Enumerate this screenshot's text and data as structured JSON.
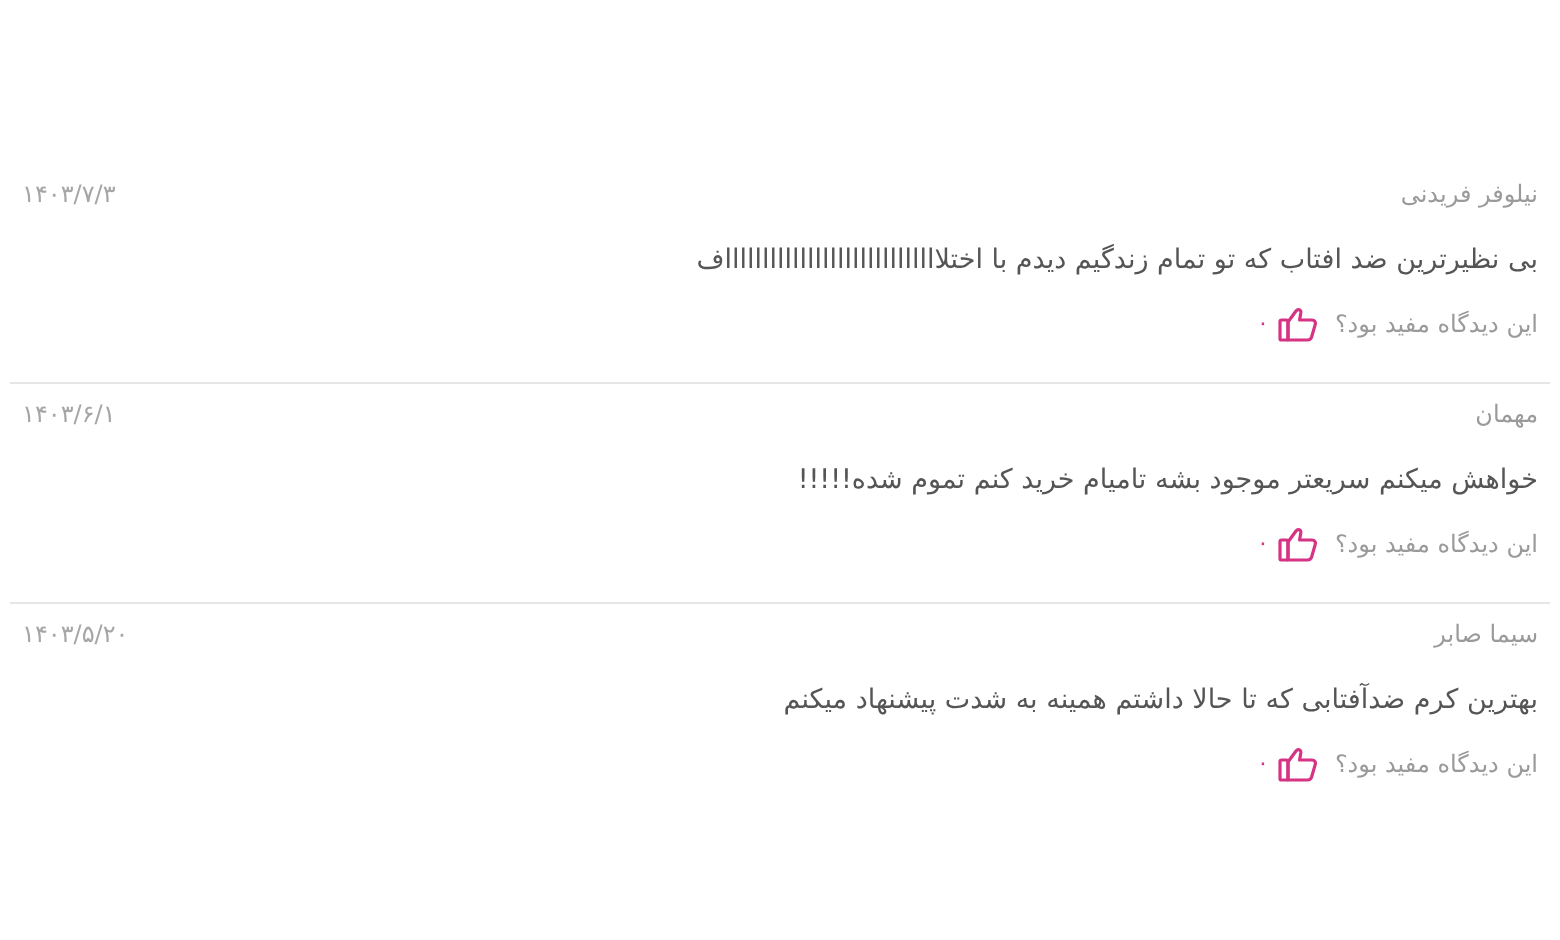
{
  "comments": [
    {
      "author": "نیلوفر فریدنی",
      "date": "۱۴۰۳/۷/۳",
      "text": "بی نظیرترین ضد افتاب که تو تمام زندگیم دیدم با اختلاااااااااااااااااااااااااااااف",
      "helpful_label": "این دیدگاه مفید بود؟",
      "likes": "۰"
    },
    {
      "author": "مهمان",
      "date": "۱۴۰۳/۶/۱",
      "text": "خواهش میکنم سریعتر موجود بشه تامیام خرید کنم تموم شده!!!!!",
      "helpful_label": "این دیدگاه مفید بود؟",
      "likes": "۰"
    },
    {
      "author": "سیما صابر",
      "date": "۱۴۰۳/۵/۲۰",
      "text": "بهترین کرم ضدآفتابی که تا حالا داشتم همینه به شدت پیشنهاد میکنم",
      "helpful_label": "این دیدگاه مفید بود؟",
      "likes": "۰"
    }
  ]
}
